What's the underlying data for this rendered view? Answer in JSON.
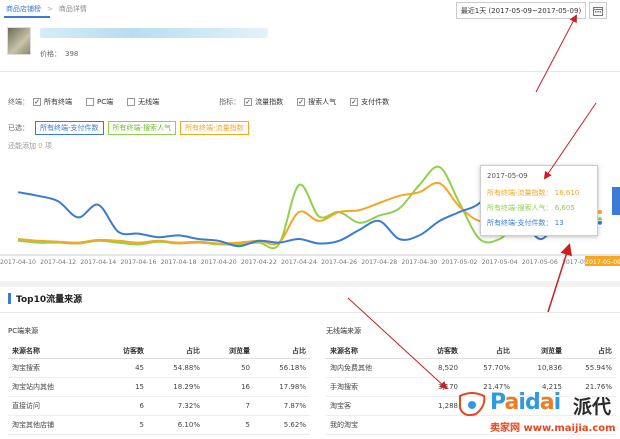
{
  "breadcrumb": {
    "home": "商品店铺榜",
    "current": "商品详情"
  },
  "product": {
    "price_label": "价格：",
    "price_value": "398"
  },
  "date_range": {
    "text": "最近1天 (2017-05-09~2017-05-09)"
  },
  "filters": {
    "terminal_label": "终端：",
    "terminals": [
      {
        "label": "所有终端",
        "checked": true
      },
      {
        "label": "PC端",
        "checked": false
      },
      {
        "label": "无线端",
        "checked": false
      }
    ],
    "metric_label": "指标：",
    "metrics": [
      {
        "label": "流量指数",
        "checked": true
      },
      {
        "label": "搜索人气",
        "checked": true
      },
      {
        "label": "支付件数",
        "checked": true
      }
    ]
  },
  "chosen": {
    "label": "已选：",
    "tags": [
      "所有终端-支付件数",
      "所有终端-搜索人气",
      "所有终端-流量指数"
    ]
  },
  "added": {
    "prefix": "还能添加",
    "count": "0",
    "suffix": "项"
  },
  "tooltip": {
    "date": "2017-05-09",
    "rows": [
      {
        "label": "所有终端-流量指数",
        "value": "16,610"
      },
      {
        "label": "所有终端-搜索人气",
        "value": "6,605"
      },
      {
        "label": "所有终端-支付件数",
        "value": "13"
      }
    ]
  },
  "chart_data": {
    "type": "line",
    "x": [
      "2017-04-10",
      "2017-04-11",
      "2017-04-12",
      "2017-04-13",
      "2017-04-14",
      "2017-04-15",
      "2017-04-16",
      "2017-04-17",
      "2017-04-18",
      "2017-04-19",
      "2017-04-20",
      "2017-04-21",
      "2017-04-22",
      "2017-04-23",
      "2017-04-24",
      "2017-04-25",
      "2017-04-26",
      "2017-04-27",
      "2017-04-28",
      "2017-04-29",
      "2017-04-30",
      "2017-05-01",
      "2017-05-02",
      "2017-05-03",
      "2017-05-04",
      "2017-05-05",
      "2017-05-06",
      "2017-05-07",
      "2017-05-08",
      "2017-05-09"
    ],
    "tick_labels": [
      "2017-04-10",
      "2017-04-12",
      "2017-04-14",
      "2017-04-16",
      "2017-04-18",
      "2017-04-20",
      "2017-04-22",
      "2017-04-24",
      "2017-04-26",
      "2017-04-28",
      "2017-04-30",
      "2017-05-02",
      "2017-05-04",
      "2017-05-06",
      "2017-05-08",
      "2017-05-09"
    ],
    "series": [
      {
        "name": "所有终端-支付件数",
        "color": "#3a7bd5",
        "values": [
          62,
          58,
          52,
          34,
          48,
          18,
          16,
          12,
          14,
          10,
          8,
          2,
          8,
          6,
          10,
          5,
          8,
          20,
          30,
          10,
          14,
          30,
          40,
          50,
          78,
          40,
          10,
          30,
          30,
          28
        ]
      },
      {
        "name": "所有终端-搜索人气",
        "color": "#8fd14f",
        "values": [
          8,
          6,
          6,
          5,
          8,
          6,
          4,
          7,
          5,
          6,
          4,
          4,
          6,
          4,
          70,
          35,
          40,
          28,
          36,
          44,
          70,
          90,
          50,
          10,
          10,
          30,
          32,
          30,
          30,
          32
        ]
      },
      {
        "name": "所有终端-流量指数",
        "color": "#f5a623",
        "values": [
          10,
          8,
          7,
          6,
          9,
          8,
          6,
          8,
          6,
          7,
          5,
          6,
          8,
          6,
          40,
          30,
          40,
          42,
          50,
          58,
          62,
          72,
          46,
          30,
          34,
          40,
          42,
          40,
          42,
          40
        ]
      }
    ],
    "ylim": [
      0,
      100
    ],
    "grid": false,
    "legend": "tooltip"
  },
  "section": {
    "title": "Top10流量来源"
  },
  "pc_table": {
    "title": "PC端来源",
    "headers": [
      "来源名称",
      "访客数",
      "占比",
      "浏览量",
      "占比"
    ],
    "rows": [
      [
        "淘宝搜索",
        "45",
        "54.88%",
        "50",
        "56.18%"
      ],
      [
        "淘宝站内其他",
        "15",
        "18.29%",
        "16",
        "17.98%"
      ],
      [
        "直接访问",
        "6",
        "7.32%",
        "7",
        "7.87%"
      ],
      [
        "淘宝其他店铺",
        "5",
        "6.10%",
        "5",
        "5.62%"
      ]
    ]
  },
  "mobile_table": {
    "title": "无线端来源",
    "headers": [
      "来源名称",
      "访客数",
      "占比",
      "浏览量",
      "占比"
    ],
    "rows": [
      [
        "淘内免费其他",
        "8,520",
        "57.70%",
        "10,836",
        "55.94%"
      ],
      [
        "手淘搜索",
        "3,170",
        "21.47%",
        "4,215",
        "21.76%"
      ],
      [
        "淘宝客",
        "1,288",
        "",
        "",
        " "
      ],
      [
        "我的淘宝",
        "",
        "",
        "",
        ""
      ]
    ]
  },
  "watermark": {
    "brand": "Paidai",
    "brand_cn": "派代",
    "site": "卖家网 www.maijia.com"
  }
}
